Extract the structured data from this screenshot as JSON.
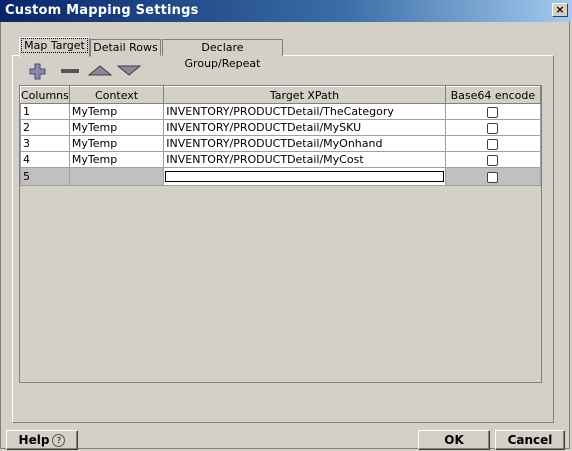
{
  "window": {
    "title": "Custom Mapping Settings",
    "close_label": "×"
  },
  "tabs": [
    {
      "label": "Map Target",
      "active": true
    },
    {
      "label": "Detail Rows",
      "active": false
    },
    {
      "label": "Declare Group/Repeat",
      "active": false
    }
  ],
  "toolbar": {
    "icons": [
      "plus-icon",
      "minus-icon",
      "move-up-icon",
      "move-down-icon"
    ]
  },
  "table": {
    "headers": [
      "Columns",
      "Context",
      "Target XPath",
      "Base64 encode"
    ],
    "rows": [
      {
        "col": "1",
        "context": "MyTemp",
        "xpath": "INVENTORY/PRODUCTDetail/TheCategory",
        "base64": false
      },
      {
        "col": "2",
        "context": "MyTemp",
        "xpath": "INVENTORY/PRODUCTDetail/MySKU",
        "base64": false
      },
      {
        "col": "3",
        "context": "MyTemp",
        "xpath": "INVENTORY/PRODUCTDetail/MyOnhand",
        "base64": false
      },
      {
        "col": "4",
        "context": "MyTemp",
        "xpath": "INVENTORY/PRODUCTDetail/MyCost",
        "base64": false
      },
      {
        "col": "5",
        "context": "",
        "xpath": "",
        "base64": false
      }
    ]
  },
  "buttons": {
    "help": "Help",
    "ok": "OK",
    "cancel": "Cancel"
  },
  "colors": {
    "titlebar_start": "#0a246a",
    "titlebar_end": "#a6caf0",
    "face": "#d4d0c8"
  }
}
